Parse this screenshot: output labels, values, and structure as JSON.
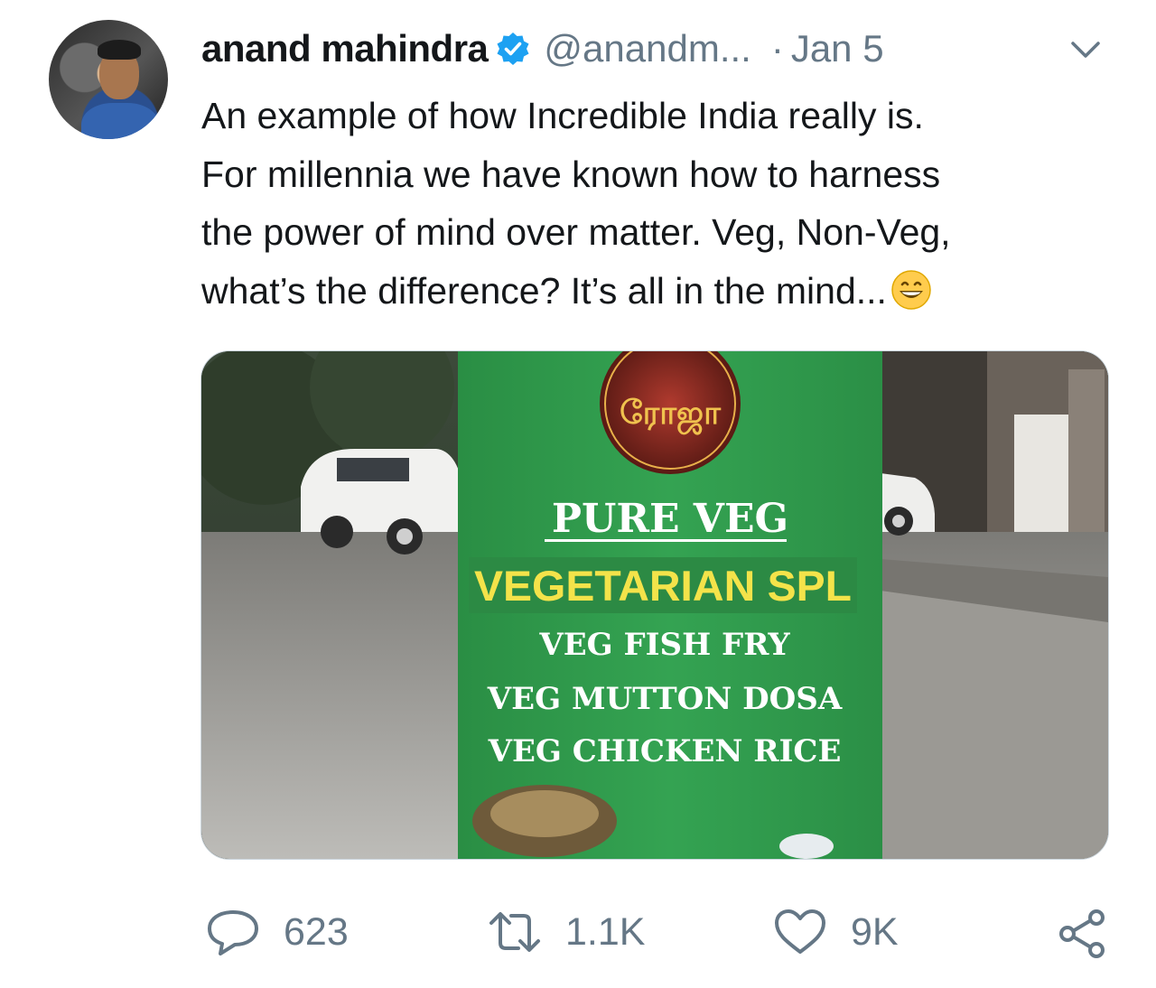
{
  "tweet": {
    "author_name": "anand mahindra",
    "handle": "@anandm...",
    "separator": "·",
    "date": "Jan 5",
    "text_lines": [
      "An example of how Incredible India really is.",
      "For millennia we have known how to harness",
      "the power of mind over matter. Veg, Non-Veg,",
      "what’s the difference? It’s all in the mind..."
    ],
    "emoji_icon": "grinning-face-emoji"
  },
  "media": {
    "sign": {
      "logo_text": "ரோஜா",
      "heading": "PURE VEG",
      "subheading": "VEGETARIAN SPL",
      "items": [
        "VEG FISH FRY",
        "VEG MUTTON DOSA",
        "VEG CHICKEN RICE"
      ]
    }
  },
  "actions": {
    "replies": "623",
    "retweets": "1.1K",
    "likes": "9K"
  },
  "icons": {
    "verified": "verified-badge-icon",
    "more": "chevron-down-icon",
    "reply": "reply-icon",
    "retweet": "retweet-icon",
    "like": "heart-icon",
    "share": "share-icon"
  },
  "colors": {
    "verified_blue": "#1da1f2",
    "secondary_text": "#657786",
    "sign_green": "#2f9a4c",
    "sign_yellow": "#f4e34a"
  }
}
